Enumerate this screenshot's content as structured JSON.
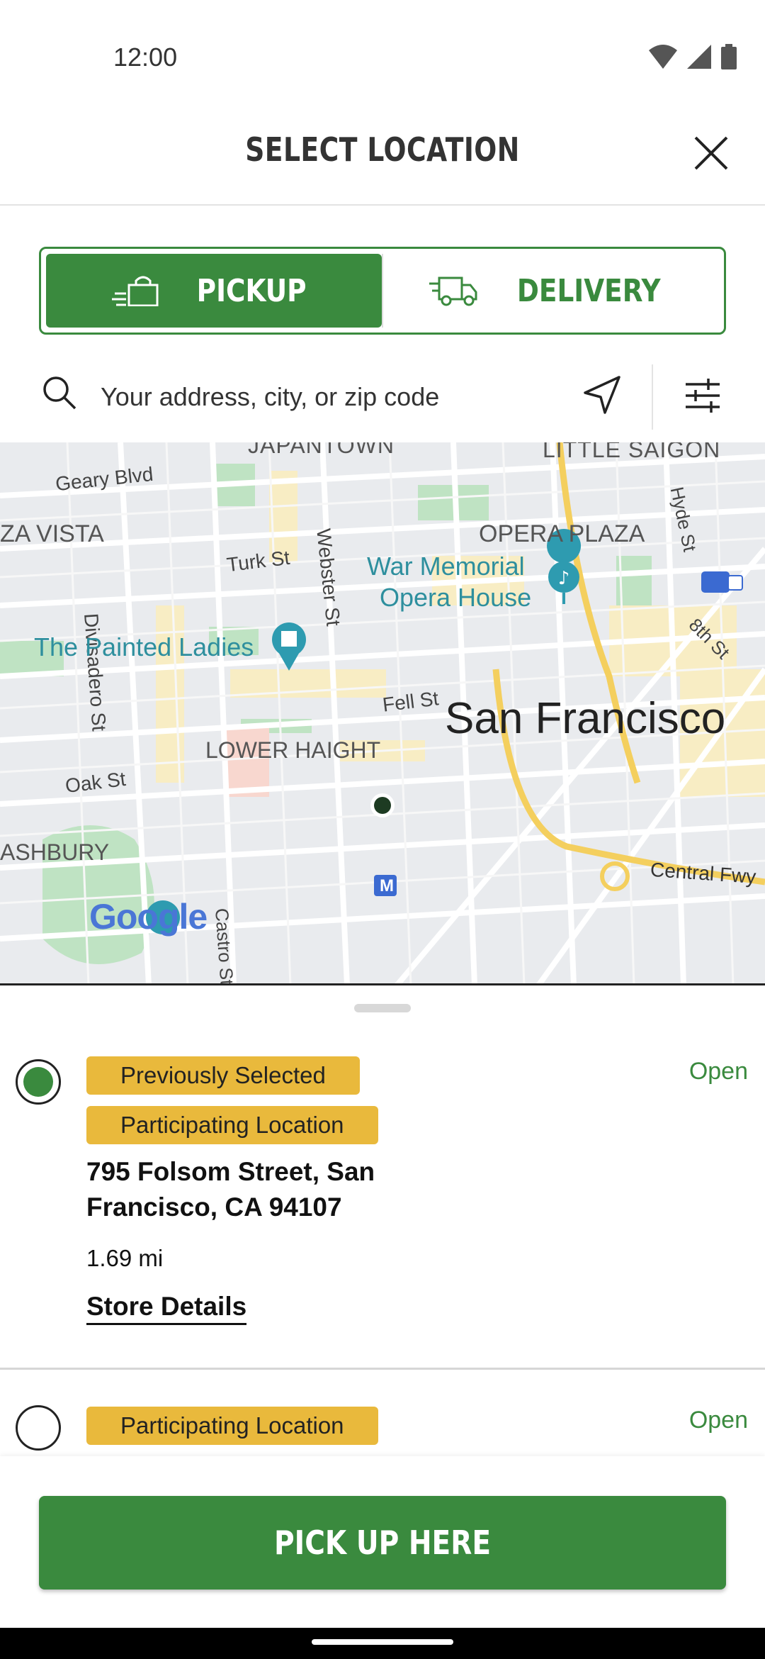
{
  "status_bar": {
    "time": "12:00"
  },
  "header": {
    "title": "SELECT LOCATION"
  },
  "mode_toggle": {
    "pickup_label": "PICKUP",
    "delivery_label": "DELIVERY",
    "selected": "pickup"
  },
  "search": {
    "placeholder": "Your address, city, or zip code"
  },
  "map": {
    "labels": {
      "japantown": "JAPANTOWN",
      "little_saigon": "LITTLE SAIGON",
      "geary": "Geary Blvd",
      "vista": "ZA VISTA",
      "divisadero": "Divisadero St",
      "turk": "Turk St",
      "webster": "Webster St",
      "war_memorial_1": "War Memorial",
      "war_memorial_2": "Opera House",
      "opera_plaza": "OPERA PLAZA",
      "hyde": "Hyde St",
      "eighth": "8th St",
      "painted_ladies": "The Painted Ladies",
      "fell": "Fell St",
      "san_francisco": "San Francisco",
      "lower_haight": "LOWER HAIGHT",
      "oak": "Oak St",
      "ashbury": "ASHBURY",
      "central_fwy": "Central Fwy",
      "castro": "Castro St",
      "google": "Google",
      "metro": "M"
    }
  },
  "locations": [
    {
      "badges": [
        "Previously Selected",
        "Participating Location"
      ],
      "status": "Open",
      "address": "795 Folsom Street, San Francisco, CA 94107",
      "distance": "1.69 mi",
      "details_label": "Store Details",
      "selected": true
    },
    {
      "badges": [
        "Participating Location"
      ],
      "status": "Open",
      "selected": false
    }
  ],
  "cta": {
    "label": "PICK UP HERE"
  },
  "colors": {
    "brand_green": "#3a8a3e",
    "badge_yellow": "#e9b93c"
  }
}
